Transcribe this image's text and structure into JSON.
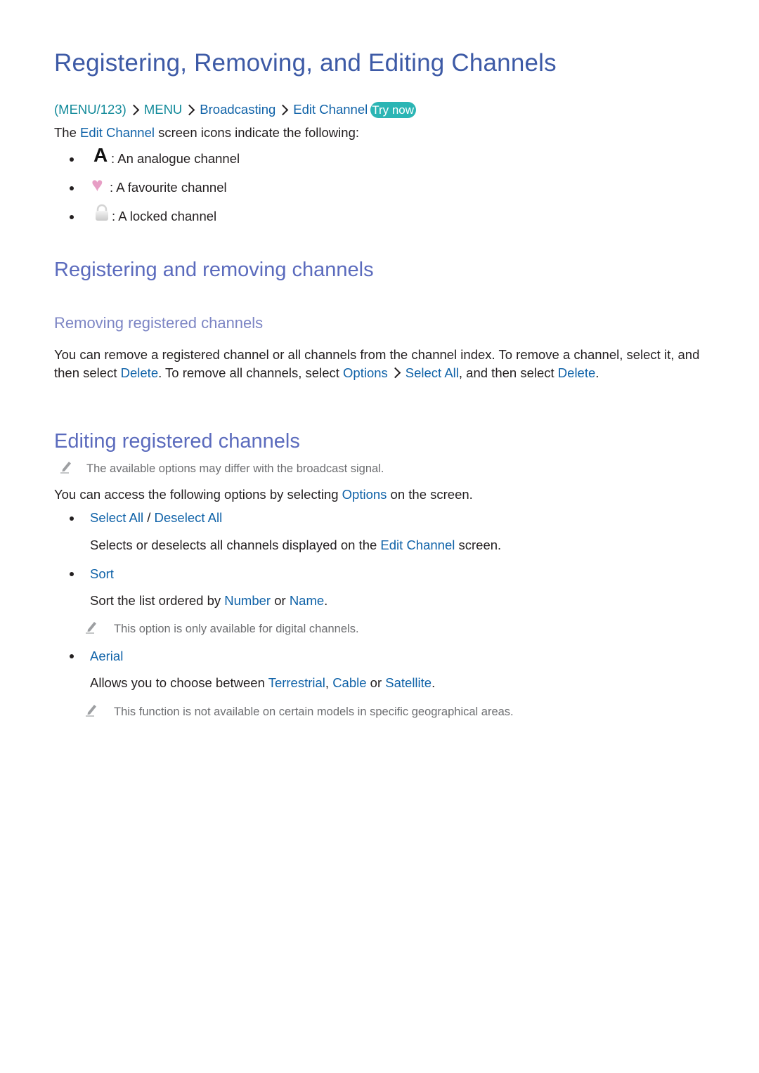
{
  "title": "Registering, Removing, and Editing Channels",
  "breadcrumb": {
    "items": [
      "(MENU/123)",
      "MENU",
      "Broadcasting",
      "Edit Channel"
    ],
    "try_now": "Try now"
  },
  "intro": {
    "prefix": "The ",
    "link": "Edit Channel",
    "suffix": " screen icons indicate the following:"
  },
  "icon_legend": [
    {
      "icon": "analogue-icon",
      "glyph": "A",
      "text": ": An analogue channel"
    },
    {
      "icon": "heart-icon",
      "glyph": "♥",
      "text": ": A favourite channel"
    },
    {
      "icon": "lock-icon",
      "glyph": "",
      "text": ": A locked channel"
    }
  ],
  "section1": {
    "heading": "Registering and removing channels",
    "subheading": "Removing registered channels",
    "para": {
      "t1": "You can remove a registered channel or all channels from the channel index. To remove a channel, select it, and then select ",
      "l1": "Delete",
      "t2": ". To remove all channels, select ",
      "l2": "Options",
      "l3": "Select All",
      "t3": ", and then select ",
      "l4": "Delete",
      "t4": "."
    }
  },
  "section2": {
    "heading": "Editing registered channels",
    "note": "The available options may differ with the broadcast signal.",
    "intro": {
      "t1": "You can access the following options by selecting ",
      "l1": "Options",
      "t2": " on the screen."
    },
    "options": [
      {
        "title_a": "Select All",
        "sep": " / ",
        "title_b": "Deselect All",
        "desc": {
          "t1": "Selects or deselects all channels displayed on the ",
          "l1": "Edit Channel",
          "t2": " screen."
        }
      },
      {
        "title_a": "Sort",
        "desc": {
          "t1": "Sort the list ordered by ",
          "l1": "Number",
          "t2": " or ",
          "l2": "Name",
          "t3": "."
        },
        "note": "This option is only available for digital channels."
      },
      {
        "title_a": "Aerial",
        "desc": {
          "t1": "Allows you to choose between ",
          "l1": "Terrestrial",
          "t2": ", ",
          "l2": "Cable",
          "t3": " or ",
          "l3": "Satellite",
          "t4": "."
        },
        "note": "This function is not available on certain models in specific geographical areas."
      }
    ]
  }
}
